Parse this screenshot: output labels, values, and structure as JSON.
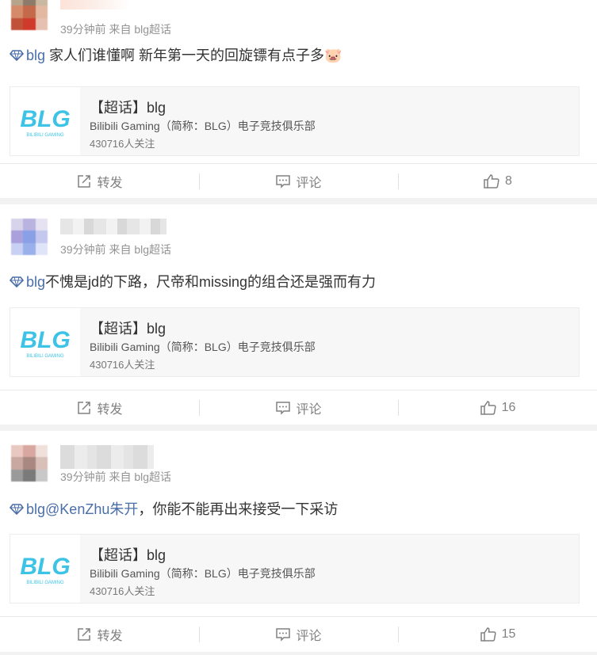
{
  "posts": [
    {
      "meta": "39分钟前 来自 blg超话",
      "tag": "blg",
      "text": " 家人们谁懂啊 新年第一天的回旋镖有点子多🐷",
      "topic_card": {
        "title": "【超话】blg",
        "subtitle": "Bilibili Gaming（简称：BLG）电子竞技俱乐部",
        "followers": "430716人关注",
        "logo_text": "BLG",
        "logo_subtext": "BILIBILI GAMING"
      },
      "actions": {
        "repost": "转发",
        "comment": "评论",
        "like_count": "8"
      }
    },
    {
      "meta": "39分钟前 来自 blg超话",
      "tag": "blg",
      "text": "不愧是jd的下路，尺帝和missing的组合还是强而有力",
      "topic_card": {
        "title": "【超话】blg",
        "subtitle": "Bilibili Gaming（简称：BLG）电子竞技俱乐部",
        "followers": "430716人关注",
        "logo_text": "BLG",
        "logo_subtext": "BILIBILI GAMING"
      },
      "actions": {
        "repost": "转发",
        "comment": "评论",
        "like_count": "16"
      }
    },
    {
      "meta": "39分钟前 来自 blg超话",
      "tag": "blg",
      "mention": "@KenZhu朱开",
      "text": "，你能不能再出来接受一下采访",
      "topic_card": {
        "title": "【超话】blg",
        "subtitle": "Bilibili Gaming（简称：BLG）电子竞技俱乐部",
        "followers": "430716人关注",
        "logo_text": "BLG",
        "logo_subtext": "BILIBILI GAMING"
      },
      "actions": {
        "repost": "转发",
        "comment": "评论",
        "like_count": "15"
      }
    }
  ],
  "colors": {
    "link": "#4a6ea8",
    "meta": "#939393",
    "logo": "#3cc3e6",
    "icon": "#808080"
  }
}
